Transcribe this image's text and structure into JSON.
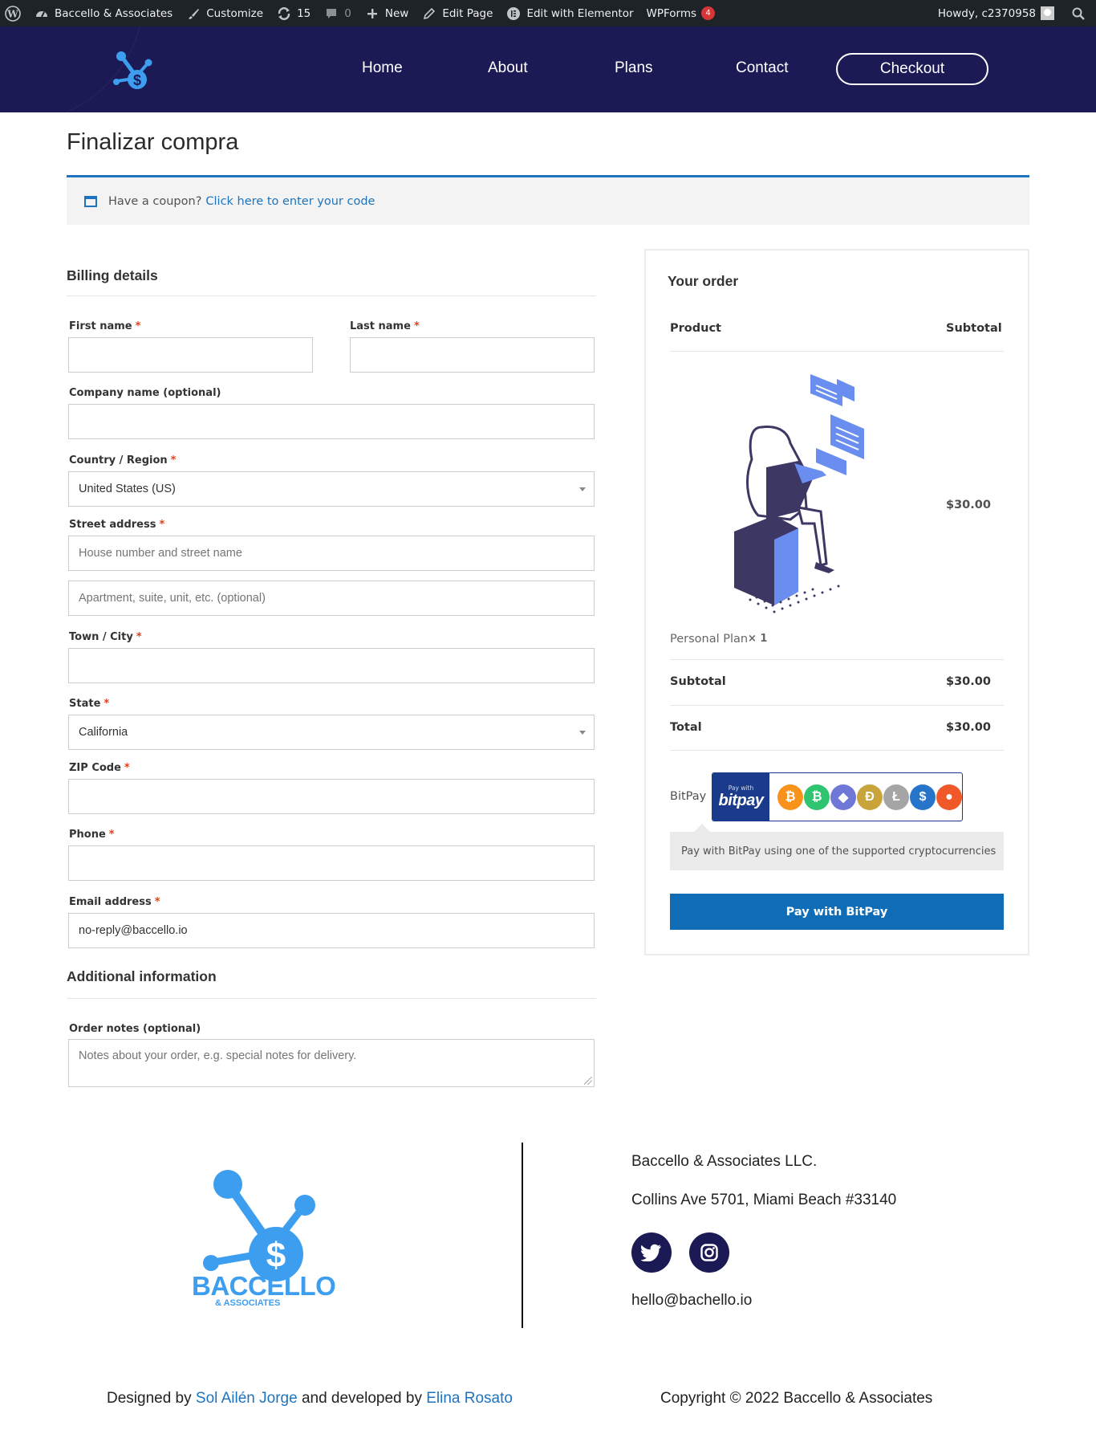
{
  "admin_bar": {
    "site_name": "Baccello & Associates",
    "customize": "Customize",
    "updates_count": "15",
    "comments_count": "0",
    "new_label": "New",
    "edit_page": "Edit Page",
    "edit_elementor": "Edit with Elementor",
    "wpforms": "WPForms",
    "wpforms_badge": "4",
    "howdy": "Howdy, c2370958"
  },
  "nav": {
    "home": "Home",
    "about": "About",
    "plans": "Plans",
    "contact": "Contact",
    "checkout": "Checkout"
  },
  "page": {
    "title": "Finalizar compra",
    "coupon_text": "Have a coupon?",
    "coupon_link": "Click here to enter your code"
  },
  "billing": {
    "heading": "Billing details",
    "first_name_label": "First name",
    "last_name_label": "Last name",
    "company_label": "Company name (optional)",
    "country_label": "Country / Region",
    "country_value": "United States (US)",
    "street_label": "Street address",
    "street_placeholder": "House number and street name",
    "street2_placeholder": "Apartment, suite, unit, etc. (optional)",
    "city_label": "Town / City",
    "state_label": "State",
    "state_value": "California",
    "zip_label": "ZIP Code",
    "phone_label": "Phone",
    "email_label": "Email address",
    "email_value": "no-reply@baccello.io",
    "required_mark": "*"
  },
  "additional": {
    "heading": "Additional information",
    "notes_label": "Order notes (optional)",
    "notes_placeholder": "Notes about your order, e.g. special notes for delivery."
  },
  "order": {
    "heading": "Your order",
    "col_product": "Product",
    "col_subtotal": "Subtotal",
    "item_price": "$30.00",
    "item_name": "Personal Plan",
    "item_qty": "× 1",
    "subtotal_label": "Subtotal",
    "subtotal_value": "$30.00",
    "total_label": "Total",
    "total_value": "$30.00",
    "payment_method": "BitPay",
    "bitpay_small": "Pay with",
    "bitpay_big": "bitpay",
    "payment_desc": "Pay with BitPay using one of the supported cryptocurrencies",
    "pay_button": "Pay with BitPay"
  },
  "footer": {
    "logo_word": "BACCELLO",
    "logo_sub": "& ASSOCIATES",
    "company": "Baccello & Associates LLC.",
    "address": "Collins Ave 5701, Miami Beach #33140",
    "email": "hello@bachello.io",
    "designed_by": "Designed by",
    "designer": "Sol Ailén Jorge",
    "developed_by": "and developed by",
    "developer": "Elina Rosato",
    "copyright": "Copyright © 2022 Baccello & Associates"
  },
  "colors": {
    "admin_bar": "#1d2327",
    "header": "#1c1a55",
    "accent_blue": "#1e73be",
    "pay_button": "#0f6cb6",
    "logo_blue": "#3d9ef0",
    "required": "#e2401c"
  },
  "icons": {
    "wordpress": "wordpress-icon",
    "dashboard": "dashboard-icon",
    "customize": "brush-icon",
    "updates": "refresh-icon",
    "comments": "comment-icon",
    "new": "plus-icon",
    "edit": "pencil-icon",
    "elementor": "elementor-icon",
    "search": "search-icon",
    "twitter": "twitter-icon",
    "instagram": "instagram-icon"
  }
}
